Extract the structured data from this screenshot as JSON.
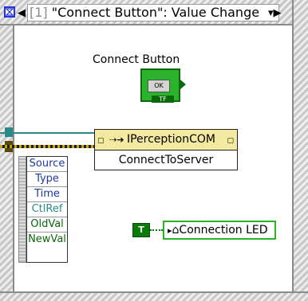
{
  "event_case": {
    "index": "[1]",
    "label": " \"Connect Button\": Value Change"
  },
  "control": {
    "caption": "Connect Button",
    "button_text": "OK",
    "type_tag": "TF"
  },
  "event_data": {
    "rows": [
      "Source",
      "Type",
      "Time",
      "CtlRef",
      "OldVal",
      "NewVal"
    ]
  },
  "invoke": {
    "class_name": "IPerceptionCOM",
    "method": "ConnectToServer"
  },
  "led": {
    "constant": "T",
    "property": "Connection LED"
  },
  "colors": {
    "frame": "#8a8a8a",
    "teal_wire": "#2a8a8a",
    "bool_green": "#2bb22b",
    "invoke_header": "#f3e9a0",
    "event_text": "#1a3aa0"
  }
}
